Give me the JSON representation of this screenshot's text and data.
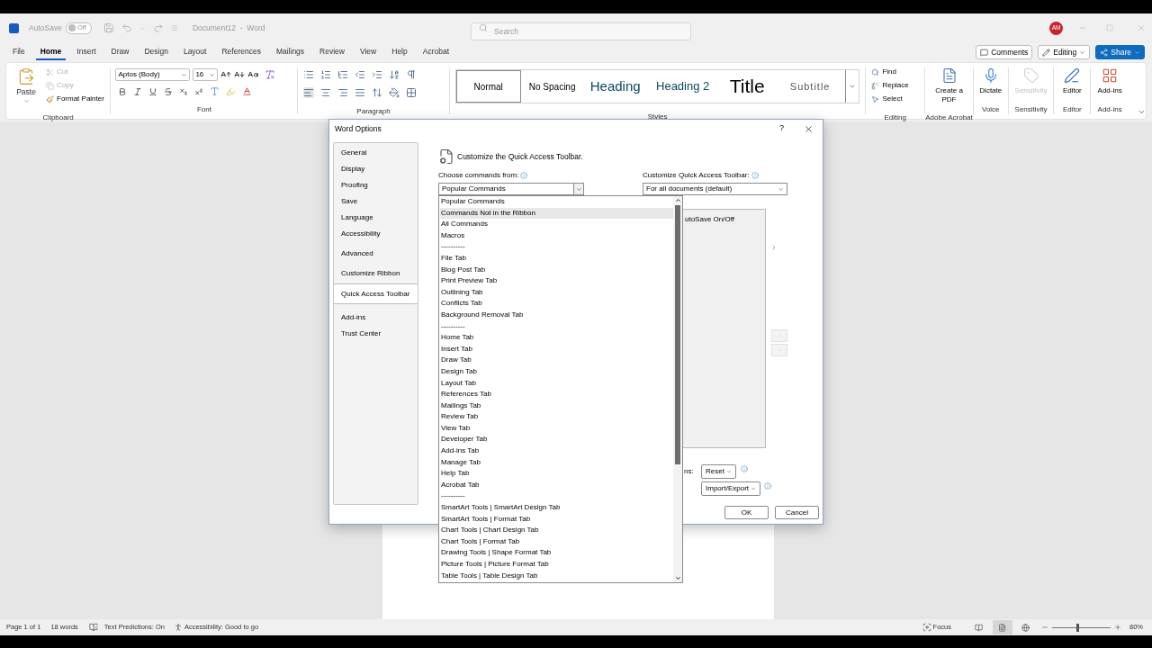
{
  "title_bar": {
    "autosave_label": "AutoSave",
    "autosave": {
      "on": false,
      "label": "Off"
    },
    "document_title": "Document12  -  Word",
    "search": {
      "placeholder": "Search"
    },
    "avatar": "AM"
  },
  "ribbon_tabs": [
    {
      "label": "File",
      "selected": false
    },
    {
      "label": "Home",
      "selected": true
    },
    {
      "label": "Insert",
      "selected": false
    },
    {
      "label": "Draw",
      "selected": false
    },
    {
      "label": "Design",
      "selected": false
    },
    {
      "label": "Layout",
      "selected": false
    },
    {
      "label": "References",
      "selected": false
    },
    {
      "label": "Mailings",
      "selected": false
    },
    {
      "label": "Review",
      "selected": false
    },
    {
      "label": "View",
      "selected": false
    },
    {
      "label": "Help",
      "selected": false
    },
    {
      "label": "Acrobat",
      "selected": false
    }
  ],
  "header_buttons": [
    {
      "label": "Comments",
      "kind": "comments"
    },
    {
      "label": "Editing",
      "kind": "mode"
    },
    {
      "label": "Share",
      "kind": "share"
    }
  ],
  "ribbon": {
    "clipboard": {
      "paste": "Paste",
      "label": "Clipboard",
      "items": [
        {
          "label": "Cut",
          "kind": "cut",
          "disabled": true
        },
        {
          "label": "Copy",
          "kind": "copy",
          "disabled": true
        },
        {
          "label": "Format Painter",
          "kind": "painter",
          "disabled": false
        }
      ]
    },
    "font": {
      "name": "Aptos (Body)",
      "size": "16",
      "label": "Font"
    },
    "paragraph": {
      "label": "Paragraph"
    },
    "styles": {
      "label": "Styles",
      "items": [
        {
          "label": "Normal",
          "kind": "body",
          "selected": true
        },
        {
          "label": "No Spacing",
          "kind": "body",
          "selected": false
        },
        {
          "label": "Heading",
          "kind": "heading",
          "selected": false
        },
        {
          "label": "Heading 2",
          "kind": "subheading",
          "selected": false
        },
        {
          "label": "Title",
          "kind": "title",
          "selected": false
        },
        {
          "label": "Subtitle",
          "kind": "subtitle",
          "selected": false
        }
      ]
    },
    "editing": {
      "label": "Editing",
      "items": [
        {
          "label": "Find",
          "kind": "find"
        },
        {
          "label": "Replace",
          "kind": "replace"
        },
        {
          "label": "Select",
          "kind": "select"
        }
      ]
    },
    "big_groups": [
      {
        "button": "Create a PDF",
        "label": "Adobe Acrobat",
        "kind": "pdf",
        "disabled": false
      },
      {
        "button": "Dictate",
        "label": "Voice",
        "kind": "mic",
        "disabled": false
      },
      {
        "button": "Sensitivity",
        "label": "Sensitivity",
        "kind": "sensitivity",
        "disabled": true
      },
      {
        "button": "Editor",
        "label": "Editor",
        "kind": "editor",
        "disabled": false
      },
      {
        "button": "Add-ins",
        "label": "Add-ins",
        "kind": "addins",
        "disabled": false
      }
    ]
  },
  "dialog": {
    "title": "Word Options",
    "help": "?",
    "nav": [
      [
        {
          "label": "General",
          "selected": false
        },
        {
          "label": "Display",
          "selected": false
        },
        {
          "label": "Proofing",
          "selected": false
        },
        {
          "label": "Save",
          "selected": false
        },
        {
          "label": "Language",
          "selected": false
        },
        {
          "label": "Accessibility",
          "selected": false
        }
      ],
      [
        {
          "label": "Advanced",
          "selected": false
        }
      ],
      [
        {
          "label": "Customize Ribbon",
          "selected": false
        },
        {
          "label": "Quick Access Toolbar",
          "selected": true
        }
      ],
      [
        {
          "label": "Add-ins",
          "selected": false
        },
        {
          "label": "Trust Center",
          "selected": false
        }
      ]
    ],
    "heading": "Customize the Quick Access Toolbar.",
    "choose_label": "Choose commands from:",
    "choose_value": "Popular Commands",
    "target_label": "Customize Quick Access Toolbar:",
    "target_value": "For all documents (default)",
    "toolbar_items": [
      "utoSave On/Off"
    ],
    "customizations_label": "ns:",
    "reset": "Reset",
    "import_export": "Import/Export",
    "ok": "OK",
    "cancel": "Cancel",
    "dropdown": [
      {
        "label": "Popular Commands",
        "selected": false
      },
      {
        "label": "Commands Not in the Ribbon",
        "selected": true
      },
      {
        "label": "All Commands",
        "selected": false
      },
      {
        "label": "Macros",
        "selected": false
      },
      {
        "label": "----------",
        "selected": false
      },
      {
        "label": "File Tab",
        "selected": false
      },
      {
        "label": "Blog Post Tab",
        "selected": false
      },
      {
        "label": "Print Preview Tab",
        "selected": false
      },
      {
        "label": "Outlining Tab",
        "selected": false
      },
      {
        "label": "Conflicts Tab",
        "selected": false
      },
      {
        "label": "Background Removal Tab",
        "selected": false
      },
      {
        "label": "----------",
        "selected": false
      },
      {
        "label": "Home Tab",
        "selected": false
      },
      {
        "label": "Insert Tab",
        "selected": false
      },
      {
        "label": "Draw Tab",
        "selected": false
      },
      {
        "label": "Design Tab",
        "selected": false
      },
      {
        "label": "Layout Tab",
        "selected": false
      },
      {
        "label": "References Tab",
        "selected": false
      },
      {
        "label": "Mailings Tab",
        "selected": false
      },
      {
        "label": "Review Tab",
        "selected": false
      },
      {
        "label": "View Tab",
        "selected": false
      },
      {
        "label": "Developer Tab",
        "selected": false
      },
      {
        "label": "Add-ins Tab",
        "selected": false
      },
      {
        "label": "Manage Tab",
        "selected": false
      },
      {
        "label": "Help Tab",
        "selected": false
      },
      {
        "label": "Acrobat Tab",
        "selected": false
      },
      {
        "label": "----------",
        "selected": false
      },
      {
        "label": "SmartArt Tools | SmartArt Design Tab",
        "selected": false
      },
      {
        "label": "SmartArt Tools | Format Tab",
        "selected": false
      },
      {
        "label": "Chart Tools | Chart Design Tab",
        "selected": false
      },
      {
        "label": "Chart Tools | Format Tab",
        "selected": false
      },
      {
        "label": "Drawing Tools | Shape Format Tab",
        "selected": false
      },
      {
        "label": "Picture Tools | Picture Format Tab",
        "selected": false
      },
      {
        "label": "Table Tools | Table Design Tab",
        "selected": false
      }
    ]
  },
  "status_bar": {
    "page": "Page 1 of 1",
    "words": "18 words",
    "predictions": "Text Predictions: On",
    "accessibility": "Accessibility: Good to go",
    "focus": "Focus",
    "views": [
      {
        "kind": "read",
        "selected": false
      },
      {
        "kind": "print",
        "selected": true
      },
      {
        "kind": "web",
        "selected": false
      }
    ],
    "zoom": {
      "level": 0.42,
      "label": "80%"
    }
  }
}
